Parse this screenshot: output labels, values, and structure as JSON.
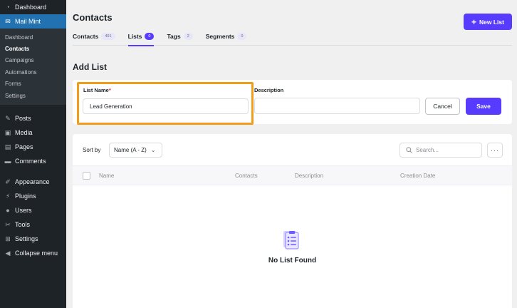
{
  "sidebar": {
    "top_items": [
      {
        "label": "Dashboard",
        "icon": "dashboard-icon"
      },
      {
        "label": "Mail Mint",
        "icon": "mail-icon",
        "current": true
      }
    ],
    "submenu": [
      {
        "label": "Dashboard"
      },
      {
        "label": "Contacts",
        "active": true
      },
      {
        "label": "Campaigns"
      },
      {
        "label": "Automations"
      },
      {
        "label": "Forms"
      },
      {
        "label": "Settings"
      }
    ],
    "items_a": [
      {
        "label": "Posts",
        "icon": "pin-icon"
      },
      {
        "label": "Media",
        "icon": "media-icon"
      },
      {
        "label": "Pages",
        "icon": "pages-icon"
      },
      {
        "label": "Comments",
        "icon": "comments-icon"
      }
    ],
    "items_b": [
      {
        "label": "Appearance",
        "icon": "brush-icon"
      },
      {
        "label": "Plugins",
        "icon": "plug-icon"
      },
      {
        "label": "Users",
        "icon": "user-icon"
      },
      {
        "label": "Tools",
        "icon": "wrench-icon"
      },
      {
        "label": "Settings",
        "icon": "settings-icon"
      },
      {
        "label": "Collapse menu",
        "icon": "collapse-icon"
      }
    ]
  },
  "header": {
    "title": "Contacts",
    "new_list_label": "New List"
  },
  "tabs": [
    {
      "label": "Contacts",
      "count": "401"
    },
    {
      "label": "Lists",
      "count": "0",
      "active": true
    },
    {
      "label": "Tags",
      "count": "2"
    },
    {
      "label": "Segments",
      "count": "0"
    }
  ],
  "add_list": {
    "title": "Add List",
    "name_label": "List Name",
    "required_mark": "*",
    "name_value": "Lead Generation",
    "description_label": "Description",
    "description_value": "",
    "cancel_label": "Cancel",
    "save_label": "Save"
  },
  "list_table": {
    "sort_label": "Sort by",
    "sort_value": "Name (A - Z)",
    "search_placeholder": "Search...",
    "columns": [
      "Name",
      "Contacts",
      "Description",
      "Creation Date"
    ],
    "empty_text": "No List Found"
  },
  "colors": {
    "accent": "#573bff",
    "highlight": "#f29d1a",
    "sidebar_bg": "#1d2327",
    "sidebar_current": "#2271b1"
  }
}
